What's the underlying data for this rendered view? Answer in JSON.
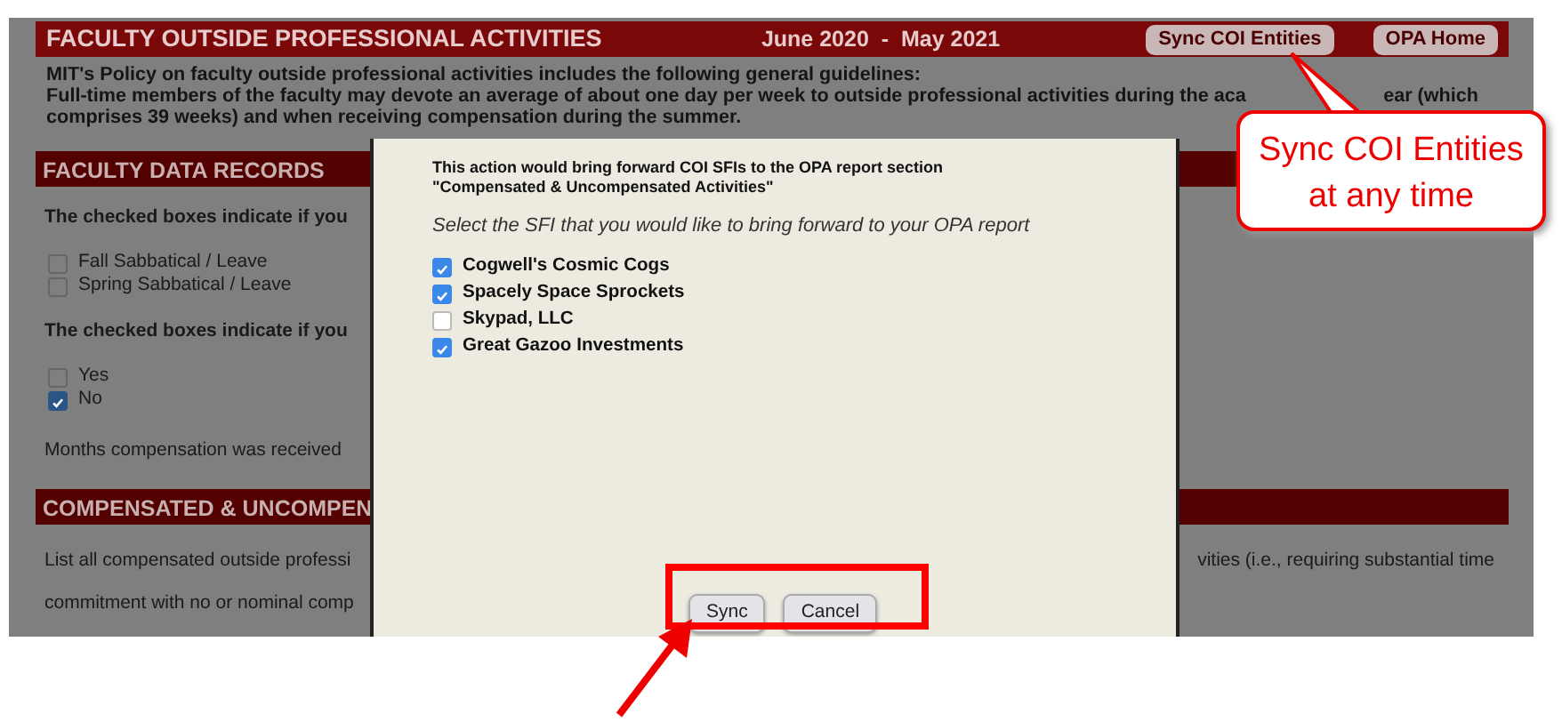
{
  "header": {
    "title": "FACULTY OUTSIDE PROFESSIONAL ACTIVITIES",
    "date_range": "June 2020  -  May 2021",
    "buttons": [
      "Sync COI Entities",
      "OPA Home"
    ]
  },
  "policy": {
    "intro": "MIT's Policy on faculty outside professional activities includes the following general guidelines:",
    "line_2_left": "Full-time members of the faculty may devote an average of about one day per week to outside professional activities during the aca",
    "line_2_right": "ear (which",
    "line_3": "comprises 39 weeks) and when receiving compensation during the summer."
  },
  "faculty_data_records": {
    "heading": "FACULTY DATA RECORDS",
    "question_1": "The checked boxes indicate if you",
    "options_1": [
      {
        "label": "Fall Sabbatical / Leave",
        "checked": false
      },
      {
        "label": "Spring Sabbatical / Leave",
        "checked": false
      }
    ],
    "question_2": "The checked boxes indicate if you",
    "options_2": [
      {
        "label": "Yes",
        "checked": false
      },
      {
        "label": "No",
        "checked": true
      }
    ],
    "months_label": "Months compensation was received"
  },
  "compensated": {
    "heading": "COMPENSATED & UNCOMPEN",
    "line_1_left": "List all compensated outside professi",
    "line_1_right": "vities (i.e., requiring substantial time",
    "line_2_left": "commitment with no or nominal comp"
  },
  "modal": {
    "notice": [
      "This action would bring forward COI SFIs to the OPA report section",
      "\"Compensated & Uncompensated Activities\""
    ],
    "instruction": "Select the SFI that you would like to bring forward to your OPA report",
    "entities": [
      {
        "label": "Cogwell's Cosmic Cogs",
        "checked": true
      },
      {
        "label": "Spacely Space Sprockets",
        "checked": true
      },
      {
        "label": "Skypad, LLC",
        "checked": false
      },
      {
        "label": "Great Gazoo Investments",
        "checked": true
      }
    ],
    "buttons": [
      "Sync",
      "Cancel"
    ]
  },
  "callout": {
    "lines": [
      "Sync COI Entities",
      "at any time"
    ]
  }
}
